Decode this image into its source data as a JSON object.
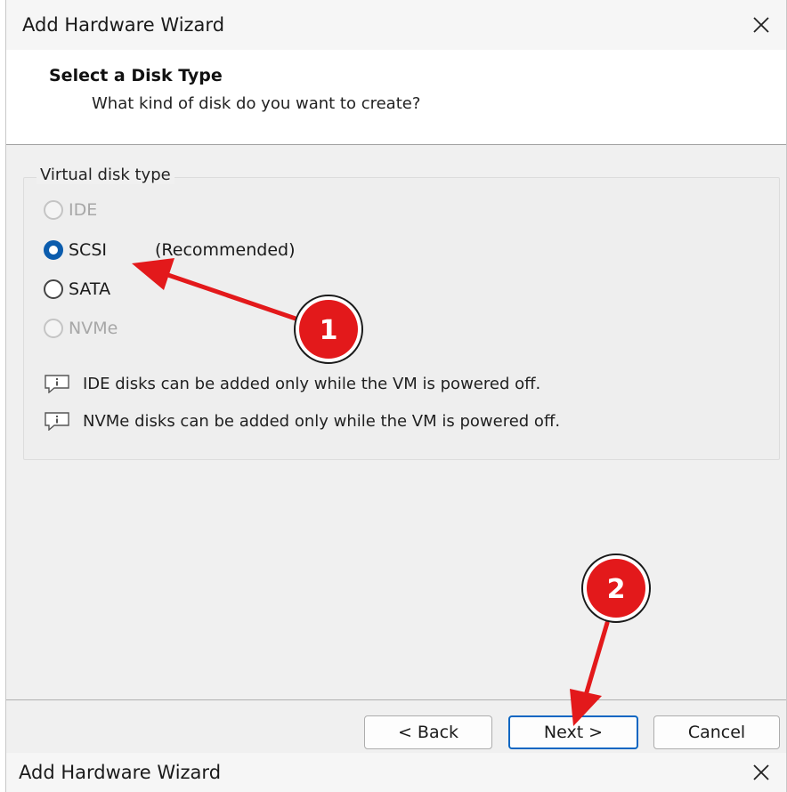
{
  "window": {
    "title": "Add Hardware Wizard",
    "close_icon": "close-icon"
  },
  "header": {
    "title": "Select a Disk Type",
    "subtitle": "What kind of disk do you want to create?"
  },
  "disk_type_group": {
    "legend": "Virtual disk type",
    "options": [
      {
        "label": "IDE",
        "enabled": false,
        "selected": false
      },
      {
        "label": "SCSI",
        "note": "(Recommended)",
        "enabled": true,
        "selected": true
      },
      {
        "label": "SATA",
        "enabled": true,
        "selected": false
      },
      {
        "label": "NVMe",
        "enabled": false,
        "selected": false
      }
    ],
    "notes": [
      "IDE disks can be added only while the VM is powered off.",
      "NVMe disks can be added only while the VM is powered off."
    ]
  },
  "buttons": {
    "back": "< Back",
    "next": "Next >",
    "cancel": "Cancel"
  },
  "second_window": {
    "title": "Add Hardware Wizard"
  },
  "annotations": [
    {
      "number": "1",
      "target": "scsi-radio"
    },
    {
      "number": "2",
      "target": "next-button"
    }
  ],
  "colors": {
    "accent": "#0b5cad",
    "annotation_red": "#e3191b",
    "dialog_bg": "#f0f0f0"
  }
}
